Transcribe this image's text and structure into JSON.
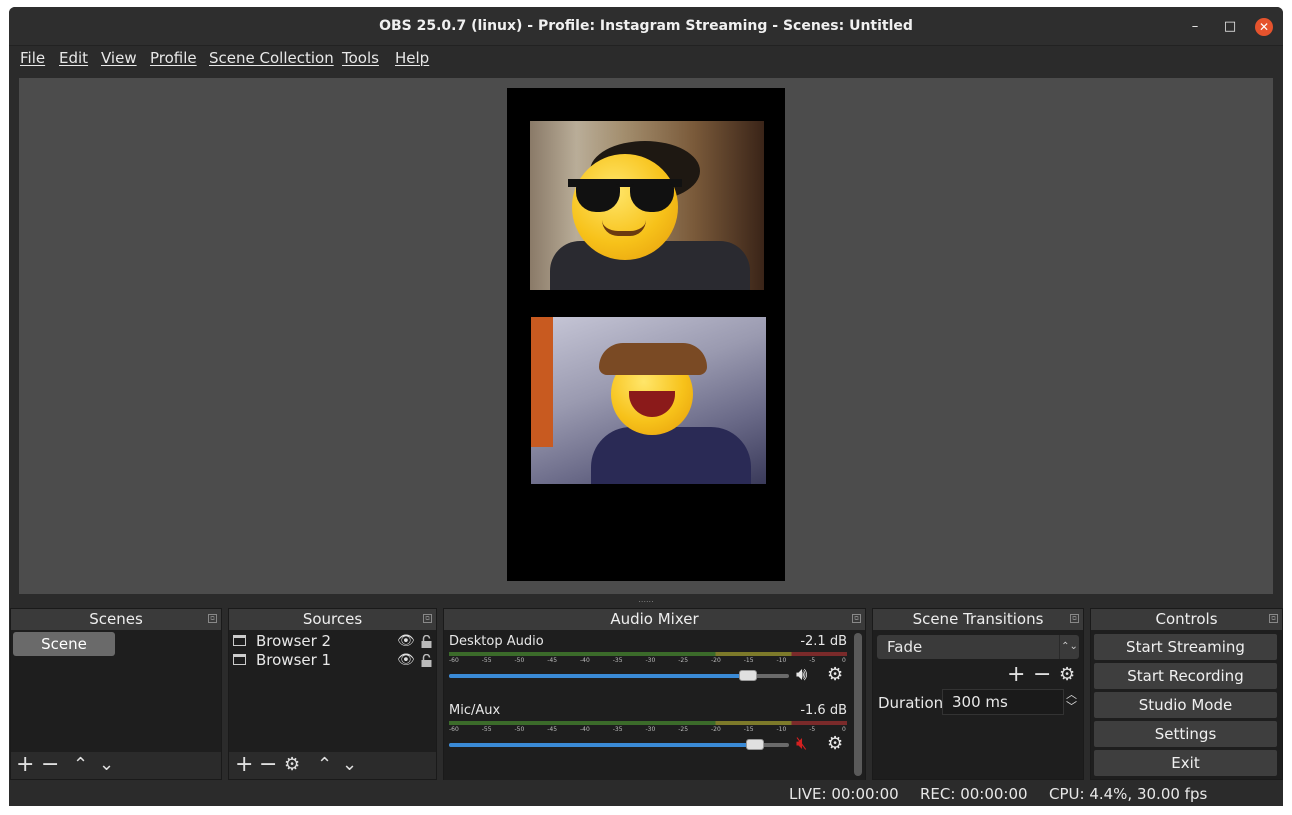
{
  "window": {
    "title": "OBS 25.0.7 (linux) - Profile: Instagram Streaming - Scenes: Untitled",
    "minimize_icon": "minimize-icon",
    "maximize_icon": "maximize-icon",
    "close_icon": "close-icon"
  },
  "menu": [
    "File",
    "Edit",
    "View",
    "Profile",
    "Scene Collection",
    "Tools",
    "Help"
  ],
  "scenes": {
    "title": "Scenes",
    "items": [
      "Scene"
    ]
  },
  "sources": {
    "title": "Sources",
    "items": [
      "Browser 2",
      "Browser 1"
    ]
  },
  "mixer": {
    "title": "Audio Mixer",
    "channels": [
      {
        "name": "Desktop Audio",
        "db": "-2.1 dB",
        "volume": 0.88,
        "muted": false
      },
      {
        "name": "Mic/Aux",
        "db": "-1.6 dB",
        "volume": 0.9,
        "muted": true
      }
    ],
    "ticks": [
      "-60",
      "-55",
      "-50",
      "-45",
      "-40",
      "-35",
      "-30",
      "-25",
      "-20",
      "-15",
      "-10",
      "-5",
      "0"
    ]
  },
  "transitions": {
    "title": "Scene Transitions",
    "selected": "Fade",
    "duration_label": "Duration",
    "duration_value": "300 ms"
  },
  "controls": {
    "title": "Controls",
    "buttons": [
      "Start Streaming",
      "Start Recording",
      "Studio Mode",
      "Settings",
      "Exit"
    ]
  },
  "status": {
    "live": "LIVE: 00:00:00",
    "rec": "REC: 00:00:00",
    "cpu": "CPU: 4.4%, 30.00 fps"
  },
  "colors": {
    "accent": "#3a8ad6",
    "close": "#e5532d",
    "muted": "#d42020"
  }
}
